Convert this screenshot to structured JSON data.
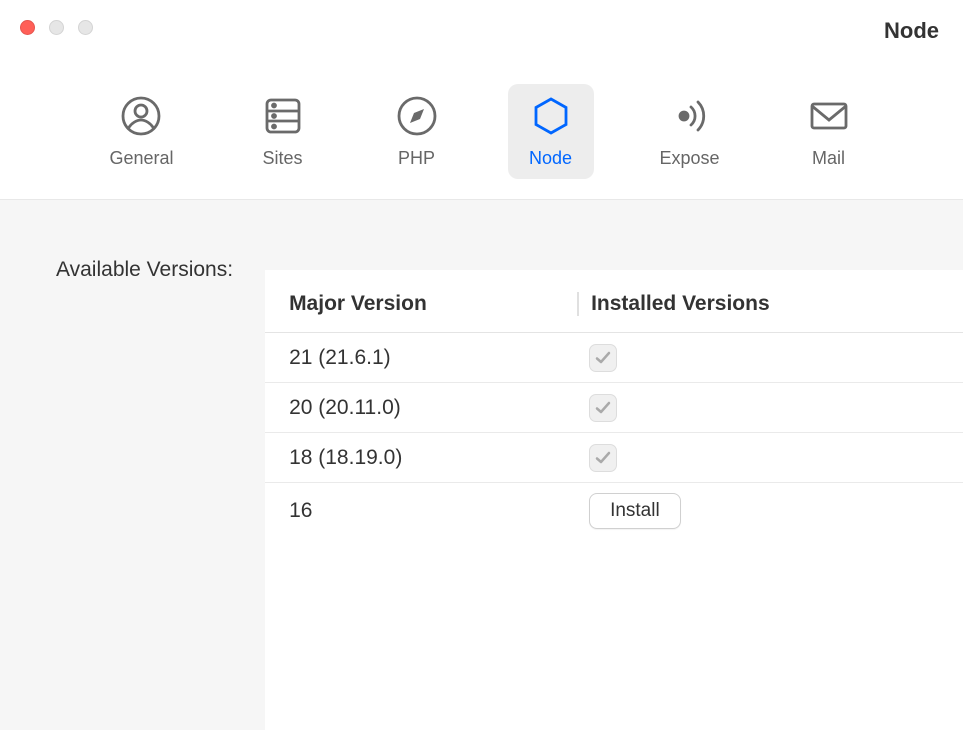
{
  "window": {
    "title": "Node"
  },
  "toolbar": {
    "items": [
      {
        "label": "General",
        "icon": "user-circle-icon",
        "active": false
      },
      {
        "label": "Sites",
        "icon": "server-icon",
        "active": false
      },
      {
        "label": "PHP",
        "icon": "compass-icon",
        "active": false
      },
      {
        "label": "Node",
        "icon": "hexagon-icon",
        "active": true
      },
      {
        "label": "Expose",
        "icon": "broadcast-icon",
        "active": false
      },
      {
        "label": "Mail",
        "icon": "envelope-icon",
        "active": false
      }
    ]
  },
  "content": {
    "section_label": "Available Versions:",
    "table": {
      "headers": {
        "major": "Major Version",
        "installed": "Installed Versions"
      },
      "rows": [
        {
          "major": "21 (21.6.1)",
          "installed": true
        },
        {
          "major": "20 (20.11.0)",
          "installed": true
        },
        {
          "major": "18 (18.19.0)",
          "installed": true
        },
        {
          "major": "16",
          "installed": false,
          "action_label": "Install"
        }
      ]
    }
  }
}
